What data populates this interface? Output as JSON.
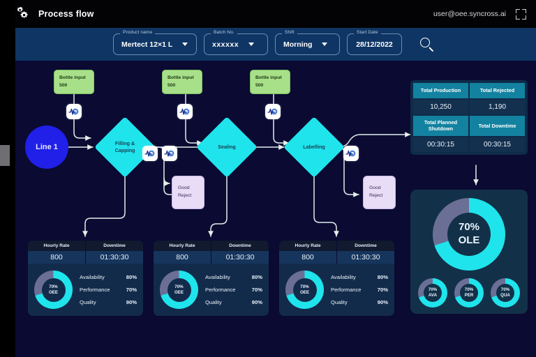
{
  "header": {
    "title": "Process flow",
    "gear_icon": "gear-icon",
    "user": "user@oee.syncross.ai",
    "expand_icon": "fullscreen-icon"
  },
  "filters": {
    "product": {
      "label": "Product name",
      "value": "Mertect 12×1 L"
    },
    "batch": {
      "label": "Batch No.",
      "value": "xxxxxx"
    },
    "shift": {
      "label": "Shift",
      "value": "Morning"
    },
    "date": {
      "label": "Start Date",
      "value": "28/12/2022"
    },
    "search_icon": "search-icon"
  },
  "flow": {
    "line_node": "Line 1",
    "inputs": [
      {
        "title": "Bottle input",
        "value": "500"
      },
      {
        "title": "Bottle input",
        "value": "500"
      },
      {
        "title": "Bottle input",
        "value": "500"
      }
    ],
    "stages": [
      {
        "label_line1": "Filling &",
        "label_line2": "Capping"
      },
      {
        "label_line1": "Sealing",
        "label_line2": ""
      },
      {
        "label_line1": "Labelling",
        "label_line2": ""
      }
    ],
    "rejects": [
      {
        "line1": "Good",
        "line2": "Reject"
      },
      {
        "line1": "Good",
        "line2": "Reject"
      }
    ],
    "sensor_icon": "sensor-waveform-icon"
  },
  "totals": [
    {
      "label": "Total Production",
      "value": "10,250"
    },
    {
      "label": "Total Rejected",
      "value": "1,190"
    },
    {
      "label": "Total Planned Shutdown",
      "value": "00:30:15"
    },
    {
      "label": "Total Downtime",
      "value": "00:30:15"
    }
  ],
  "ole": {
    "main": {
      "value": "70%",
      "label": "OLE",
      "percent": 70
    },
    "minis": [
      {
        "value": "70%",
        "label": "AVA",
        "percent": 70
      },
      {
        "value": "70%",
        "label": "PER",
        "percent": 70
      },
      {
        "value": "70%",
        "label": "QUA",
        "percent": 70
      }
    ]
  },
  "kpi_cards": [
    {
      "head": [
        "Hourly Rate",
        "Downtime"
      ],
      "values": [
        "800",
        "01:30:30"
      ],
      "donut": {
        "value": "70%",
        "label": "OEE",
        "percent": 70
      },
      "rows": [
        {
          "name": "Availability",
          "pct": "80%"
        },
        {
          "name": "Performance",
          "pct": "70%"
        },
        {
          "name": "Quality",
          "pct": "90%"
        }
      ]
    },
    {
      "head": [
        "Hourly Rate",
        "Downtime"
      ],
      "values": [
        "800",
        "01:30:30"
      ],
      "donut": {
        "value": "70%",
        "label": "OEE",
        "percent": 70
      },
      "rows": [
        {
          "name": "Availability",
          "pct": "80%"
        },
        {
          "name": "Performance",
          "pct": "70%"
        },
        {
          "name": "Quality",
          "pct": "90%"
        }
      ]
    },
    {
      "head": [
        "Hourly Rate",
        "Downtime"
      ],
      "values": [
        "800",
        "01:30:30"
      ],
      "donut": {
        "value": "70%",
        "label": "OEE",
        "percent": 70
      },
      "rows": [
        {
          "name": "Availability",
          "pct": "80%"
        },
        {
          "name": "Performance",
          "pct": "70%"
        },
        {
          "name": "Quality",
          "pct": "90%"
        }
      ]
    }
  ],
  "colors": {
    "accent_cyan": "#1fe4ec",
    "donut_track": "#6b6f96",
    "canvas_bg": "#0a0a32",
    "filter_bg": "#0f3564",
    "teal_header": "#1382a0",
    "input_green": "#a8e08a",
    "reject_purple": "#e8dcf6",
    "line_blue": "#2020e8"
  }
}
